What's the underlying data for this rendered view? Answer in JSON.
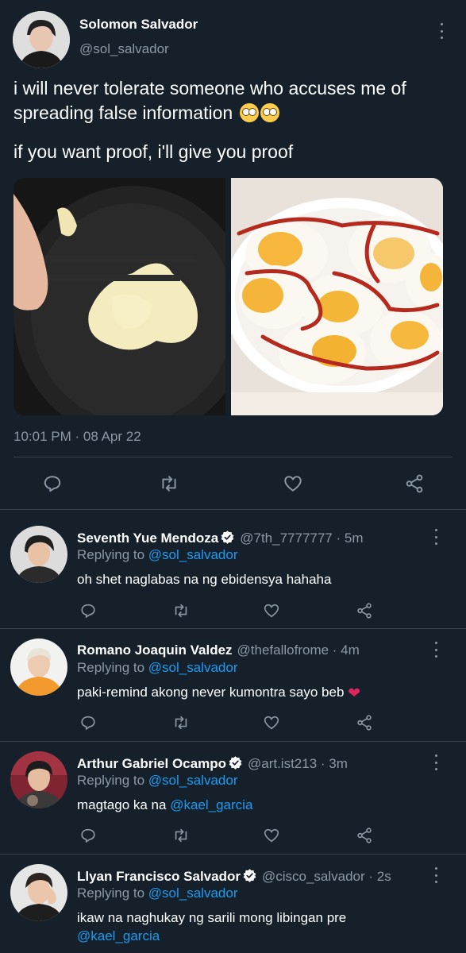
{
  "main_tweet": {
    "name": "Solomon Salvador",
    "handle": "@sol_salvador",
    "text_line1": "i will never tolerate someone who accuses me of spreading false information",
    "text_line2": "if you want proof, i'll give you proof",
    "timestamp": "10:01 PM · 08 Apr 22",
    "actions": [
      "reply-icon",
      "retweet-icon",
      "like-icon",
      "share-icon"
    ]
  },
  "replies": [
    {
      "name": "Seventh Yue Mendoza",
      "verified": true,
      "meta": "@7th_7777777 · 5m",
      "replying_prefix": "Replying to ",
      "replying_to": "@sol_salvador",
      "text": "oh shet naglabas na ng ebidensya hahaha",
      "avatar_color": "#3b3b3b"
    },
    {
      "name": "Romano Joaquin Valdez",
      "verified": false,
      "meta": "@thefallofrome · 4m",
      "replying_prefix": "Replying to ",
      "replying_to": "@sol_salvador",
      "text": "paki-remind akong never kumontra sayo beb",
      "avatar_color": "#e98a2e"
    },
    {
      "name": "Arthur Gabriel Ocampo",
      "verified": true,
      "meta": "@art.ist213 · 3m",
      "replying_prefix": "Replying to ",
      "replying_to": "@sol_salvador",
      "text_prefix": "magtago ka na ",
      "text_mention": "@kael_garcia",
      "avatar_color": "#8a2f38"
    },
    {
      "name": "Llyan Francisco Salvador",
      "verified": true,
      "meta": "@cisco_salvador · 2s",
      "replying_prefix": "Replying to ",
      "replying_to": "@sol_salvador",
      "text": "ikaw na naghukay ng sarili mong libingan pre",
      "text_mention": "@kael_garcia",
      "avatar_color": "#d8d8d8"
    }
  ],
  "colors": {
    "background": "#15202b",
    "divider": "#38444d",
    "muted": "#8b98a5",
    "link": "#1d9bf0",
    "verified": "#ffffff"
  }
}
